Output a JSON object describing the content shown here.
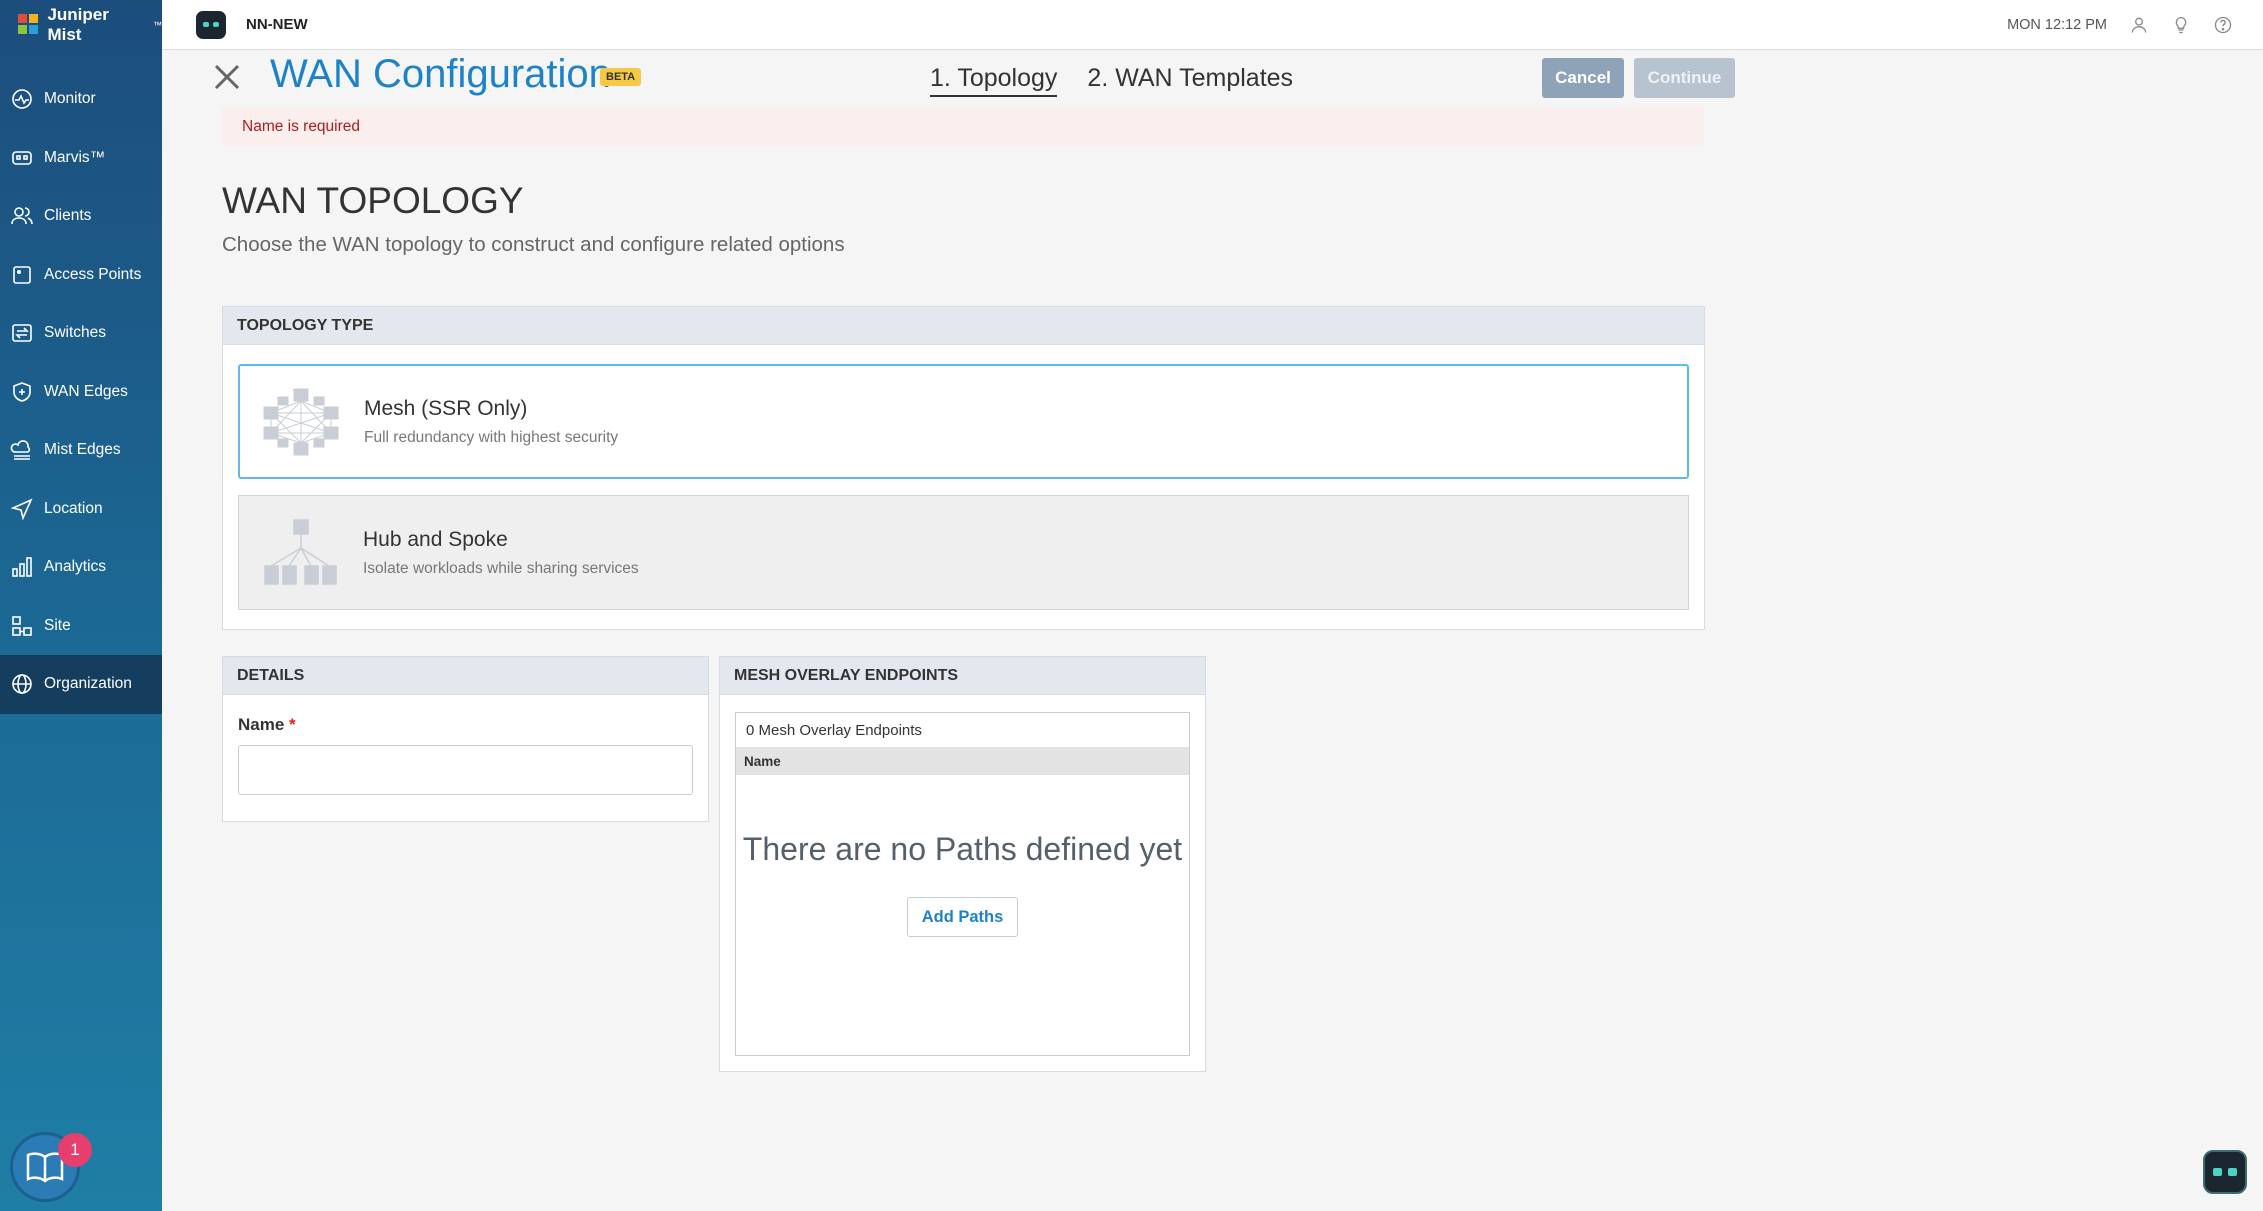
{
  "sidebar": {
    "brand": "Juniper Mist",
    "brand_tm": "™",
    "items": [
      {
        "label": "Monitor",
        "icon": "monitor-icon"
      },
      {
        "label": "Marvis™",
        "icon": "marvis-icon"
      },
      {
        "label": "Clients",
        "icon": "clients-icon"
      },
      {
        "label": "Access Points",
        "icon": "access-point-icon"
      },
      {
        "label": "Switches",
        "icon": "switches-icon"
      },
      {
        "label": "WAN Edges",
        "icon": "wan-edges-icon"
      },
      {
        "label": "Mist Edges",
        "icon": "mist-edges-icon"
      },
      {
        "label": "Location",
        "icon": "location-icon"
      },
      {
        "label": "Analytics",
        "icon": "analytics-icon"
      },
      {
        "label": "Site",
        "icon": "site-icon"
      },
      {
        "label": "Organization",
        "icon": "organization-icon"
      }
    ],
    "notification_count": "1"
  },
  "topbar": {
    "org_name": "NN-NEW",
    "datetime": "MON 12:12 PM"
  },
  "header": {
    "title": "WAN Configuration",
    "badge": "BETA",
    "steps": [
      "1. Topology",
      "2. WAN Templates"
    ],
    "cancel_label": "Cancel",
    "continue_label": "Continue"
  },
  "error_message": "Name is required",
  "section": {
    "title": "WAN TOPOLOGY",
    "subtitle": "Choose the WAN topology to construct and configure related options"
  },
  "topology": {
    "header": "TOPOLOGY TYPE",
    "options": [
      {
        "title": "Mesh (SSR Only)",
        "description": "Full redundancy with highest security"
      },
      {
        "title": "Hub and Spoke",
        "description": "Isolate workloads while sharing services"
      }
    ]
  },
  "details": {
    "header": "DETAILS",
    "name_label": "Name",
    "required_mark": "*",
    "name_value": ""
  },
  "mesh_overlay": {
    "header": "MESH OVERLAY ENDPOINTS",
    "count_text": "0 Mesh Overlay Endpoints",
    "column_name": "Name",
    "empty_text": "There are no Paths defined yet",
    "add_label": "Add Paths"
  },
  "colors": {
    "accent": "#1e82c8",
    "selected_border": "#5bbde7",
    "error_text": "#b01c1c",
    "beta_badge": "#f6c945"
  }
}
